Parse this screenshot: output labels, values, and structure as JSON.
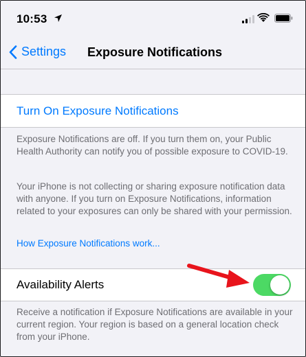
{
  "status_bar": {
    "time": "10:53",
    "icons": [
      "location-arrow-icon",
      "cellular-signal-icon",
      "wifi-icon",
      "battery-icon"
    ]
  },
  "nav": {
    "back_label": "Settings",
    "title": "Exposure Notifications"
  },
  "turn_on": {
    "label": "Turn On Exposure Notifications"
  },
  "info": {
    "paragraph1": "Exposure Notifications are off. If you turn them on, your Public Health Authority can notify you of possible exposure to COVID-19.",
    "paragraph2": "Your iPhone is not collecting or sharing exposure notification data with anyone. If you turn on Exposure Notifications, information related to your exposures can only be shared with your permission.",
    "how_link": "How Exposure Notifications work..."
  },
  "availability_alerts": {
    "label": "Availability Alerts",
    "toggle_on": true,
    "footnote": "Receive a notification if Exposure Notifications are available in your current region. Your region is based on a general location check from your iPhone."
  },
  "colors": {
    "accent": "#007aff",
    "toggle_on": "#4cd964",
    "annotation_arrow": "#e8141c",
    "background": "#f2f2f7"
  }
}
